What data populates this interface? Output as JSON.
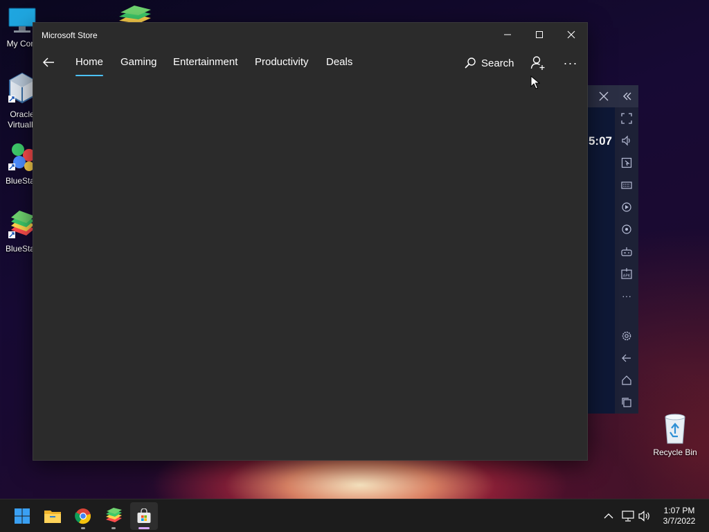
{
  "desktop": {
    "icons": [
      {
        "label": "My Com",
        "icon": "monitor-icon"
      },
      {
        "label": "Oracle",
        "label2": "VirtualB",
        "icon": "virtualbox-icon"
      },
      {
        "label": "BlueStac",
        "icon": "bluestacks-x-icon"
      },
      {
        "label": "BlueStac",
        "icon": "bluestacks-icon"
      }
    ],
    "recycle_bin": {
      "label": "Recycle Bin",
      "icon": "recycle-bin-icon"
    }
  },
  "bluestacks": {
    "time": "5:07",
    "header_buttons": [
      "close-icon",
      "collapse-icon"
    ],
    "tools": [
      "fullscreen-icon",
      "volume-icon",
      "pointer-icon",
      "keyboard-icon",
      "rotate-icon",
      "sync-icon",
      "gamepad-icon",
      "apk-icon",
      "more-icon",
      "settings-icon",
      "back-icon",
      "home-icon",
      "recent-apps-icon"
    ],
    "more_glyph": "···"
  },
  "store": {
    "title": "Microsoft Store",
    "caption": {
      "minimize": "—",
      "maximize": "□",
      "close": "✕"
    },
    "nav": {
      "tabs": [
        {
          "label": "Home",
          "selected": true
        },
        {
          "label": "Gaming",
          "selected": false
        },
        {
          "label": "Entertainment",
          "selected": false
        },
        {
          "label": "Productivity",
          "selected": false
        },
        {
          "label": "Deals",
          "selected": false
        }
      ],
      "search_label": "Search",
      "more_glyph": "···"
    },
    "accent": "#4cc2ff",
    "background": "#2b2b2b"
  },
  "taskbar": {
    "apps": [
      {
        "name": "start",
        "icon": "windows-logo-icon"
      },
      {
        "name": "file-explorer",
        "icon": "folder-icon"
      },
      {
        "name": "chrome",
        "icon": "chrome-icon"
      },
      {
        "name": "bluestacks",
        "icon": "bluestacks-icon"
      },
      {
        "name": "microsoft-store",
        "icon": "store-bag-icon",
        "active": true
      }
    ],
    "tray": {
      "chevron": "^",
      "time": "1:07 PM",
      "date": "3/7/2022"
    }
  }
}
